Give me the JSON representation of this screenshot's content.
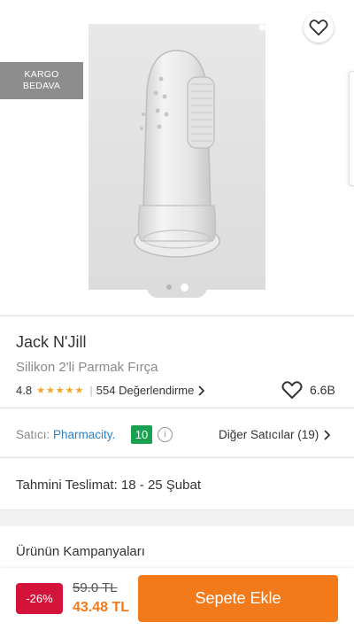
{
  "header": {
    "back_icon": "arrow-left-icon",
    "share_icon": "share-icon",
    "favorite_icon": "heart-outline-icon"
  },
  "hero": {
    "badge_line1": "KARGO",
    "badge_line2": "BEDAVA",
    "carousel": {
      "count": 2,
      "active_index": 1
    }
  },
  "product": {
    "brand": "Jack N'Jill",
    "name": "Silikon 2'li Parmak Fırça",
    "rating": "4.8",
    "stars": "★★★★★",
    "review_count": "554 Değerlendirme",
    "favorites": "6.6B"
  },
  "seller": {
    "label": "Satıcı:",
    "name": "Pharmacity.",
    "score": "10",
    "other_sellers": "Diğer Satıcılar (19)"
  },
  "delivery": {
    "text": "Tahmini Teslimat: 18 - 25 Şubat"
  },
  "campaigns": {
    "title": "Ürünün Kampanyaları"
  },
  "price": {
    "discount": "-26%",
    "old": "59.0 TL",
    "new": "43.48 TL"
  },
  "actions": {
    "add_to_cart": "Sepete Ekle"
  },
  "colors": {
    "accent": "#f27a1a",
    "discount": "#d3133a",
    "seller_score": "#1aa14f",
    "link": "#2f80c4",
    "stars": "#f5a623"
  }
}
